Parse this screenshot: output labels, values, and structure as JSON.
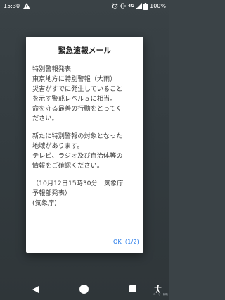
{
  "status_bar": {
    "time": "15:30",
    "network": "4G",
    "battery_percent": "100%",
    "icons": [
      "warning-icon",
      "alarm-icon",
      "vibrate-icon",
      "signal-icon",
      "battery-icon"
    ]
  },
  "dialog": {
    "title": "緊急速報メール",
    "paragraphs": [
      "特別警報発表\n東京地方に特別警報（大雨）\n災害がすでに発生していること\nを示す警戒レベル５に相当。\n命を守る最善の行動をとってく\nださい。",
      "新たに特別警報の対象となった\n地域があります。\nテレビ、ラジオ及び自治体等の\n情報をご確認ください。",
      "（10月12日15時30分　気象庁\n予報部発表）\n(気象庁)"
    ],
    "ok_label": "OK（1/2)"
  },
  "nav_bar": {
    "accessibility_label": "ユーザー補助",
    "icons": [
      "back-icon",
      "home-icon",
      "recents-icon",
      "accessibility-icon"
    ]
  },
  "colors": {
    "background": "#363e42",
    "dialog": "#ffffff",
    "accent": "#1a73e8"
  }
}
